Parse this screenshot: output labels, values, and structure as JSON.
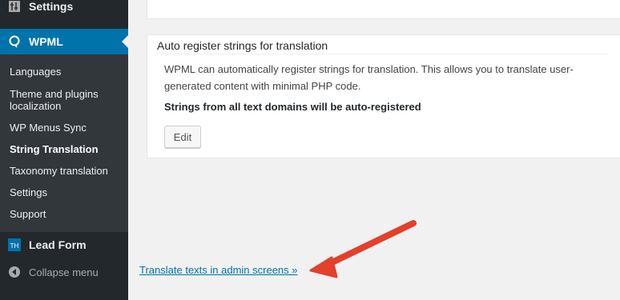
{
  "sidebar": {
    "settings_label": "Settings",
    "wpml_label": "WPML",
    "submenu": [
      "Languages",
      "Theme and plugins localization",
      "WP Menus Sync",
      "String Translation",
      "Taxonomy translation",
      "Settings",
      "Support"
    ],
    "active_submenu": "String Translation",
    "leadform_label": "Lead Form",
    "leadform_icon_text": "TH",
    "collapse_label": "Collapse menu"
  },
  "auto_register": {
    "title": "Auto register strings for translation",
    "description": "WPML can automatically register strings for translation. This allows you to translate user-generated content with minimal PHP code.",
    "status": "Strings from all text domains will be auto-registered",
    "edit_label": "Edit"
  },
  "admin_link": "Translate texts in admin screens »",
  "colors": {
    "sidebar_bg": "#23282d",
    "submenu_bg": "#32373c",
    "accent": "#0073aa",
    "arrow": "#e4402b"
  }
}
